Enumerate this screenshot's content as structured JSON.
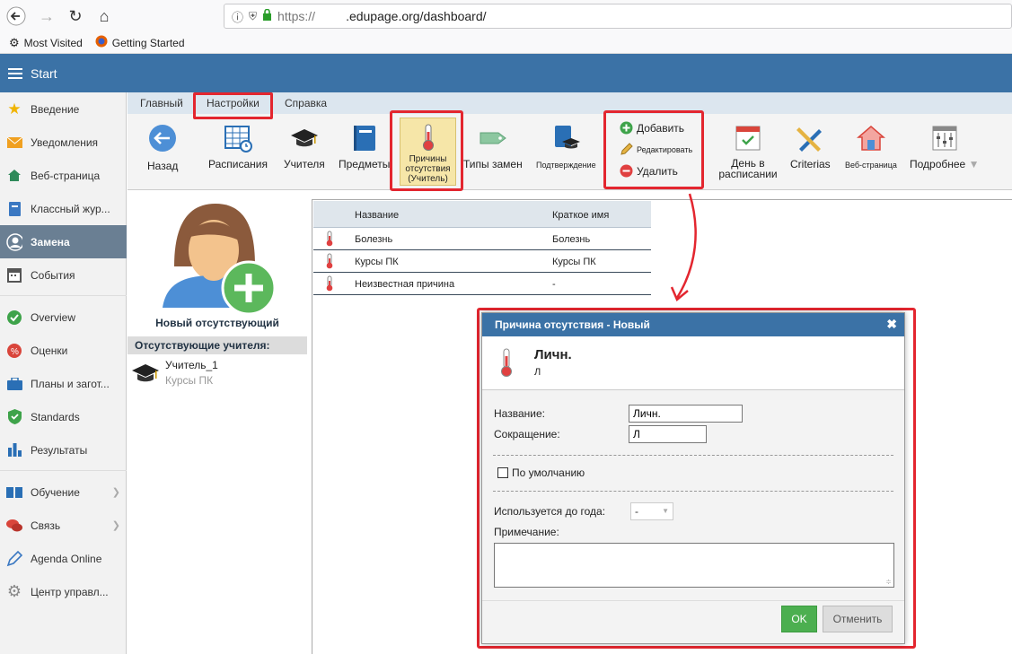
{
  "browser": {
    "url_prefix": "https://",
    "url_domain": ".edupage.org/dashboard/",
    "bookmarks": [
      "Most Visited",
      "Getting Started"
    ]
  },
  "appbar": {
    "title": "Start"
  },
  "sidebar": {
    "items": [
      {
        "label": "Введение",
        "icon": "star-icon"
      },
      {
        "label": "Уведомления",
        "icon": "envelope-icon"
      },
      {
        "label": "Веб-страница",
        "icon": "home-icon"
      },
      {
        "label": "Классный жур...",
        "icon": "book-icon"
      },
      {
        "label": "Замена",
        "icon": "user-icon"
      },
      {
        "label": "События",
        "icon": "calendar-icon"
      },
      {
        "label": "Overview",
        "icon": "check-circle-icon"
      },
      {
        "label": "Оценки",
        "icon": "grade-icon"
      },
      {
        "label": "Планы и загот...",
        "icon": "briefcase-icon"
      },
      {
        "label": "Standards",
        "icon": "shield-icon"
      },
      {
        "label": "Результаты",
        "icon": "bar-chart-icon"
      },
      {
        "label": "Обучение",
        "icon": "open-book-icon"
      },
      {
        "label": "Связь",
        "icon": "chat-icon"
      },
      {
        "label": "Agenda Online",
        "icon": "pen-icon"
      },
      {
        "label": "Центр управл...",
        "icon": "gear-icon"
      }
    ]
  },
  "ribbon": {
    "tabs": [
      "Главный",
      "Настройки",
      "Справка"
    ],
    "buttons": {
      "back": "Назад",
      "schedules": "Расписания",
      "teachers": "Учителя",
      "subjects": "Предметы",
      "absence_reasons": "Причины отсутствия (Учитель)",
      "sub_types": "Типы замен",
      "confirmation": "Подтверждение",
      "add": "Добавить",
      "edit": "Редактировать",
      "delete": "Удалить",
      "day_in_schedule": "День в расписании",
      "criterias": "Criterias",
      "web_page": "Веб-страница",
      "more": "Подробнее"
    }
  },
  "left_panel": {
    "new_absent": "Новый отсутствующий",
    "absent_header": "Отсутствующие учителя:",
    "teacher_name": "Учитель_1",
    "teacher_reason": "Курсы ПК"
  },
  "table": {
    "columns": [
      "Название",
      "Краткое имя"
    ],
    "rows": [
      {
        "name": "Болезнь",
        "short": "Болезнь"
      },
      {
        "name": "Курсы ПК",
        "short": "Курсы ПК"
      },
      {
        "name": "Неизвестная причина",
        "short": "-"
      }
    ]
  },
  "dialog": {
    "title": "Причина отсутствия - Новый",
    "head_name": "Личн.",
    "head_short": "Л",
    "name_label": "Название:",
    "name_value": "Личн.",
    "short_label": "Сокращение:",
    "short_value": "Л",
    "default_label": "По умолчанию",
    "year_label": "Используется до года:",
    "year_value": "-",
    "note_label": "Примечание:",
    "ok": "OK",
    "cancel": "Отменить"
  },
  "colors": {
    "accent": "#3b72a6",
    "highlight": "#e3262f",
    "ok_green": "#4caf50"
  }
}
